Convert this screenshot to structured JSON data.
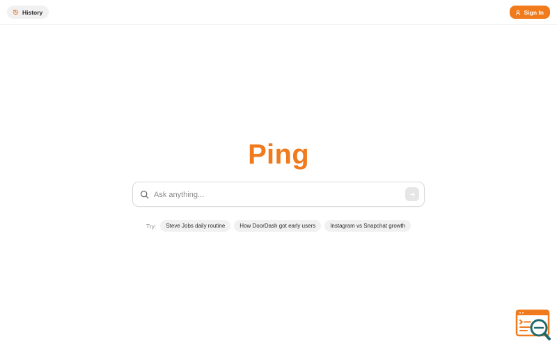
{
  "header": {
    "history_label": "History",
    "signin_label": "Sign In"
  },
  "main": {
    "logo": "Ping",
    "search": {
      "placeholder": "Ask anything...",
      "value": ""
    },
    "suggestions": {
      "try_label": "Try:",
      "chips": [
        "Steve Jobs daily routine",
        "How DoorDash got early users",
        "Instagram vs Snapchat growth"
      ]
    }
  },
  "icons": {
    "history": "history-icon",
    "user": "user-icon",
    "search": "search-icon",
    "submit": "arrow-right-icon",
    "widget": "browser-search-icon"
  },
  "colors": {
    "accent": "#f07a1c",
    "chip_bg": "#f1f1f1",
    "text": "#2b2b2b",
    "muted": "#8a8a8a"
  }
}
